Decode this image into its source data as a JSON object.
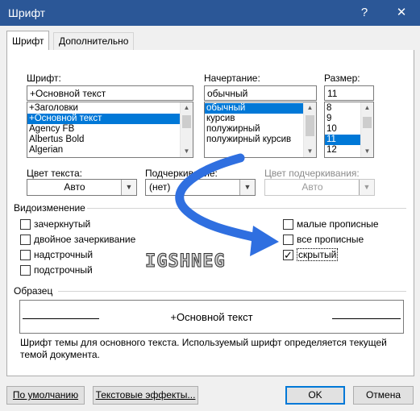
{
  "window": {
    "title": "Шрифт",
    "help": "?",
    "close": "✕"
  },
  "tabs": [
    {
      "label": "Шрифт"
    },
    {
      "label": "Дополнительно"
    }
  ],
  "font": {
    "label": "Шрифт:",
    "value": "+Основной текст",
    "items": [
      "+Заголовки",
      "+Основной текст",
      "Agency FB",
      "Albertus Bold",
      "Algerian"
    ],
    "selected_index": 1
  },
  "style": {
    "label": "Начертание:",
    "value": "обычный",
    "items": [
      "обычный",
      "курсив",
      "полужирный",
      "полужирный курсив"
    ],
    "selected_index": 0
  },
  "size": {
    "label": "Размер:",
    "value": "11",
    "items": [
      "8",
      "9",
      "10",
      "11",
      "12"
    ],
    "selected_index": 3
  },
  "text_color": {
    "label": "Цвет текста:",
    "value": "Авто"
  },
  "underline": {
    "label": "Подчеркивание:",
    "value": "(нет)"
  },
  "underline_color": {
    "label": "Цвет подчеркивания:",
    "value": "Авто"
  },
  "effects": {
    "title": "Видоизменение",
    "left": [
      {
        "label": "зачеркнутый",
        "checked": false
      },
      {
        "label": "двойное зачеркивание",
        "checked": false
      },
      {
        "label": "надстрочный",
        "checked": false
      },
      {
        "label": "подстрочный",
        "checked": false
      }
    ],
    "right": [
      {
        "label": "малые прописные",
        "checked": false
      },
      {
        "label": "все прописные",
        "checked": false
      },
      {
        "label": "скрытый",
        "checked": true
      }
    ]
  },
  "watermark": "IGSHNEG",
  "preview": {
    "title": "Образец",
    "text": "+Основной текст",
    "description": "Шрифт темы для основного текста. Используемый шрифт определяется текущей темой документа."
  },
  "buttons": {
    "default": "По умолчанию",
    "text_effects": "Текстовые эффекты...",
    "ok": "OK",
    "cancel": "Отмена"
  },
  "colors": {
    "titlebar": "#2b5797",
    "selection": "#0078d7",
    "arrow": "#2f6fe0"
  }
}
